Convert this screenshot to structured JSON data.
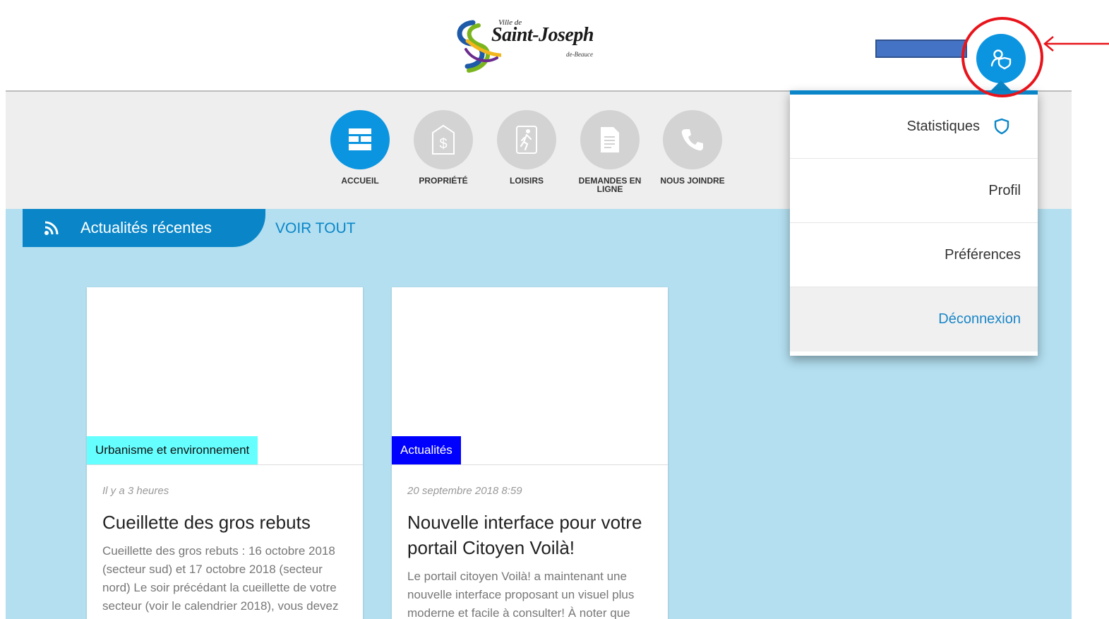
{
  "header": {
    "logo": {
      "ville": "Ville de",
      "name": "Saint-Joseph",
      "sub": "de-Beauce"
    },
    "user_button_icon": "user-shield-icon",
    "accent_color": "#0b95e0",
    "annotation_color": "#e8141c"
  },
  "nav": {
    "items": [
      {
        "label": "ACCUEIL",
        "icon": "dashboard-icon",
        "active": true
      },
      {
        "label": "PROPRIÉTÉ",
        "icon": "dollar-tag-icon",
        "active": false
      },
      {
        "label": "LOISIRS",
        "icon": "running-person-icon",
        "active": false
      },
      {
        "label": "DEMANDES EN LIGNE",
        "icon": "document-icon",
        "active": false
      },
      {
        "label": "NOUS JOINDRE",
        "icon": "phone-icon",
        "active": false
      }
    ]
  },
  "news": {
    "title": "Actualités récentes",
    "voir_tout": "VOIR TOUT",
    "cards": [
      {
        "tag": "Urbanisme et environnement",
        "tag_color": "#66ffff",
        "date": "Il y a 3 heures",
        "title": "Cueillette des gros rebuts",
        "text": "Cueillette des gros rebuts :  16 octobre 2018 (secteur sud) et 17 octobre 2018 (secteur nord) Le soir précédant la cueillette de votre secteur (voir le calendrier 2018), vous devez"
      },
      {
        "tag": "Actualités",
        "tag_color": "#0000ff",
        "date": "20 septembre 2018 8:59",
        "title": "Nouvelle interface pour votre portail Citoyen Voilà!",
        "text": "Le portail citoyen Voilà! a maintenant une nouvelle interface proposant un visuel plus moderne et facile à consulter! À noter que"
      }
    ]
  },
  "dropdown": {
    "items": [
      {
        "label": "Statistiques",
        "icon": "shield-icon"
      },
      {
        "label": "Profil"
      },
      {
        "label": "Préférences"
      },
      {
        "label": "Déconnexion"
      }
    ]
  }
}
